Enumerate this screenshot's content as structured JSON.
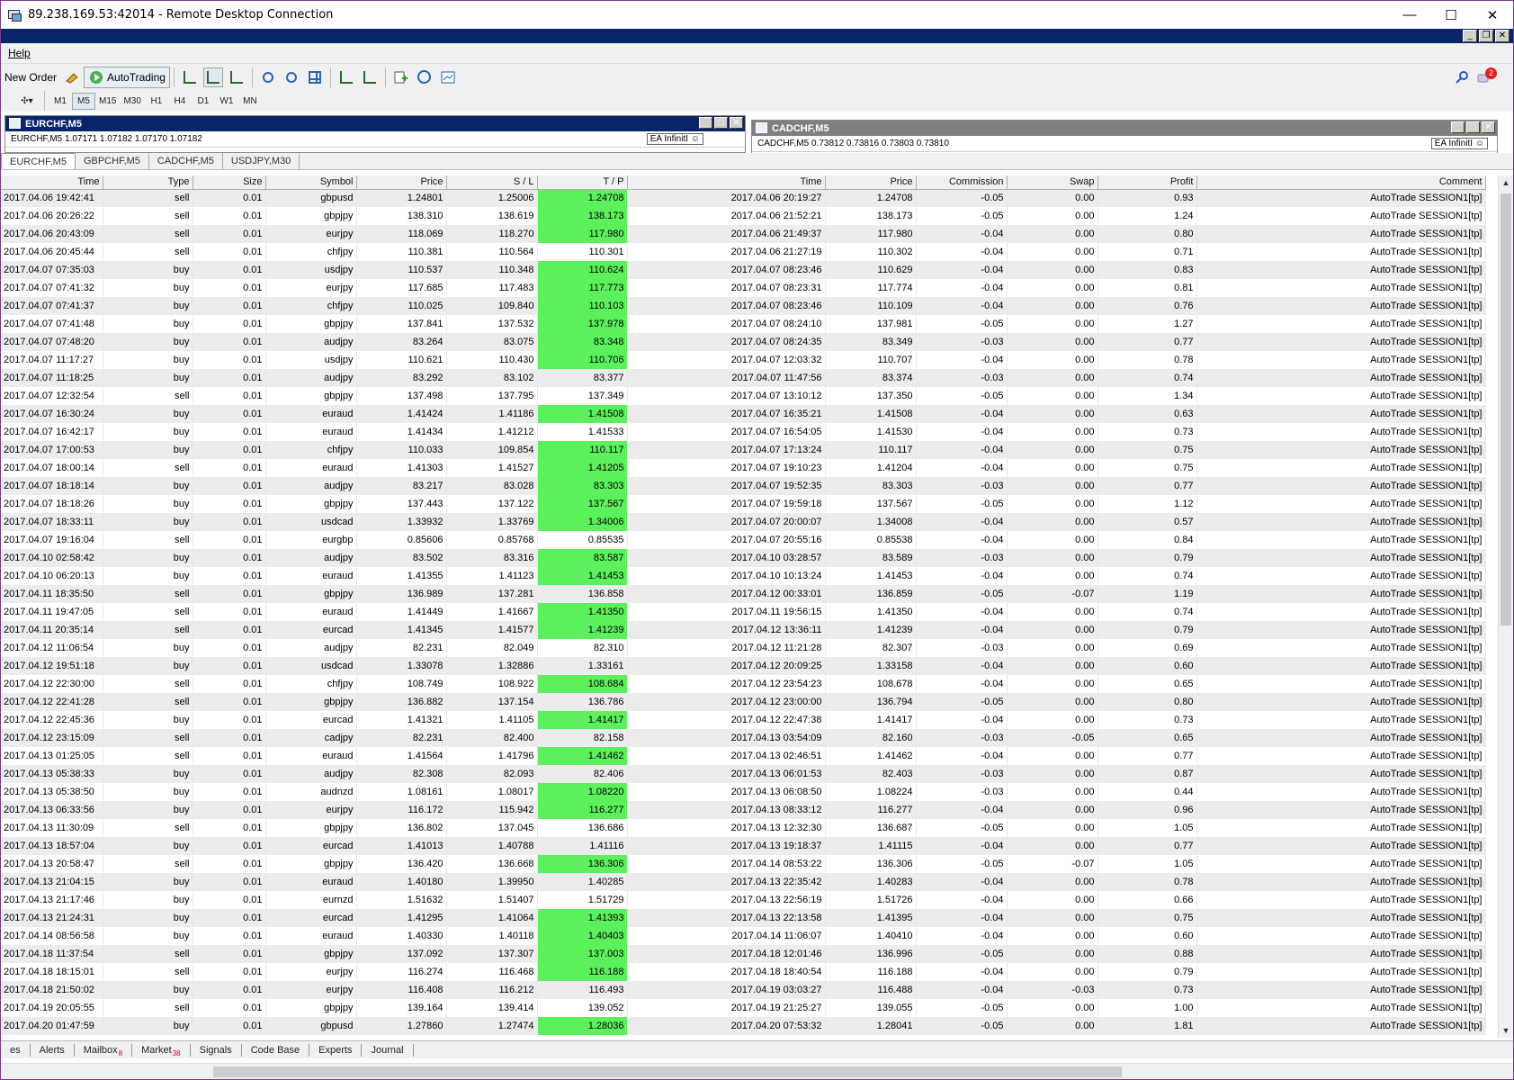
{
  "window": {
    "title": "89.238.169.53:42014 - Remote Desktop Connection",
    "minimize": "—",
    "maximize": "☐",
    "close": "✕"
  },
  "menu": {
    "help": "Help"
  },
  "toolbar": {
    "new_order": "New Order",
    "autotrading": "AutoTrading"
  },
  "timeframes": [
    "M1",
    "M5",
    "M15",
    "M30",
    "H1",
    "H4",
    "D1",
    "W1",
    "MN"
  ],
  "active_timeframe": "M5",
  "charts": {
    "left": {
      "title": "EURCHF,M5",
      "info": "EURCHF,M5  1.07171 1.07182 1.07170 1.07182",
      "ea": "EA InfinitI ☺"
    },
    "right": {
      "title": "CADCHF,M5",
      "info": "CADCHF,M5  0.73812 0.73816 0.73803 0.73810",
      "ea": "EA InfinitI ☺"
    }
  },
  "chart_tabs": [
    "EURCHF,M5",
    "GBPCHF,M5",
    "CADCHF,M5",
    "USDJPY,M30"
  ],
  "table": {
    "headers": [
      "Time",
      "Type",
      "Size",
      "Symbol",
      "Price",
      "S / L",
      "T / P",
      "Time",
      "Price",
      "Commission",
      "Swap",
      "Profit",
      "Comment"
    ],
    "rows": [
      [
        "2017.04.06 19:42:41",
        "sell",
        "0.01",
        "gbpusd",
        "1.24801",
        "1.25006",
        "1.24708",
        "2017.04.06 20:19:27",
        "1.24708",
        "-0.05",
        "0.00",
        "0.93",
        "AutoTrade SESSION1[tp]",
        1
      ],
      [
        "2017.04.06 20:26:22",
        "sell",
        "0.01",
        "gbpjpy",
        "138.310",
        "138.619",
        "138.173",
        "2017.04.06 21:52:21",
        "138.173",
        "-0.05",
        "0.00",
        "1.24",
        "AutoTrade SESSION1[tp]",
        1
      ],
      [
        "2017.04.06 20:43:09",
        "sell",
        "0.01",
        "eurjpy",
        "118.069",
        "118.270",
        "117.980",
        "2017.04.06 21:49:37",
        "117.980",
        "-0.04",
        "0.00",
        "0.80",
        "AutoTrade SESSION1[tp]",
        1
      ],
      [
        "2017.04.06 20:45:44",
        "sell",
        "0.01",
        "chfjpy",
        "110.381",
        "110.564",
        "110.301",
        "2017.04.06 21:27:19",
        "110.302",
        "-0.04",
        "0.00",
        "0.71",
        "AutoTrade SESSION1[tp]",
        0
      ],
      [
        "2017.04.07 07:35:03",
        "buy",
        "0.01",
        "usdjpy",
        "110.537",
        "110.348",
        "110.624",
        "2017.04.07 08:23:46",
        "110.629",
        "-0.04",
        "0.00",
        "0.83",
        "AutoTrade SESSION1[tp]",
        1
      ],
      [
        "2017.04.07 07:41:32",
        "buy",
        "0.01",
        "eurjpy",
        "117.685",
        "117.483",
        "117.773",
        "2017.04.07 08:23:31",
        "117.774",
        "-0.04",
        "0.00",
        "0.81",
        "AutoTrade SESSION1[tp]",
        1
      ],
      [
        "2017.04.07 07:41:37",
        "buy",
        "0.01",
        "chfjpy",
        "110.025",
        "109.840",
        "110.103",
        "2017.04.07 08:23:46",
        "110.109",
        "-0.04",
        "0.00",
        "0.76",
        "AutoTrade SESSION1[tp]",
        1
      ],
      [
        "2017.04.07 07:41:48",
        "buy",
        "0.01",
        "gbpjpy",
        "137.841",
        "137.532",
        "137.978",
        "2017.04.07 08:24:10",
        "137.981",
        "-0.05",
        "0.00",
        "1.27",
        "AutoTrade SESSION1[tp]",
        1
      ],
      [
        "2017.04.07 07:48:20",
        "buy",
        "0.01",
        "audjpy",
        "83.264",
        "83.075",
        "83.348",
        "2017.04.07 08:24:35",
        "83.349",
        "-0.03",
        "0.00",
        "0.77",
        "AutoTrade SESSION1[tp]",
        1
      ],
      [
        "2017.04.07 11:17:27",
        "buy",
        "0.01",
        "usdjpy",
        "110.621",
        "110.430",
        "110.706",
        "2017.04.07 12:03:32",
        "110.707",
        "-0.04",
        "0.00",
        "0.78",
        "AutoTrade SESSION1[tp]",
        1
      ],
      [
        "2017.04.07 11:18:25",
        "buy",
        "0.01",
        "audjpy",
        "83.292",
        "83.102",
        "83.377",
        "2017.04.07 11:47:56",
        "83.374",
        "-0.03",
        "0.00",
        "0.74",
        "AutoTrade SESSION1[tp]",
        0
      ],
      [
        "2017.04.07 12:32:54",
        "sell",
        "0.01",
        "gbpjpy",
        "137.498",
        "137.795",
        "137.349",
        "2017.04.07 13:10:12",
        "137.350",
        "-0.05",
        "0.00",
        "1.34",
        "AutoTrade SESSION1[tp]",
        0
      ],
      [
        "2017.04.07 16:30:24",
        "buy",
        "0.01",
        "euraud",
        "1.41424",
        "1.41186",
        "1.41508",
        "2017.04.07 16:35:21",
        "1.41508",
        "-0.04",
        "0.00",
        "0.63",
        "AutoTrade SESSION1[tp]",
        1
      ],
      [
        "2017.04.07 16:42:17",
        "buy",
        "0.01",
        "euraud",
        "1.41434",
        "1.41212",
        "1.41533",
        "2017.04.07 16:54:05",
        "1.41530",
        "-0.04",
        "0.00",
        "0.73",
        "AutoTrade SESSION1[tp]",
        0
      ],
      [
        "2017.04.07 17:00:53",
        "buy",
        "0.01",
        "chfjpy",
        "110.033",
        "109.854",
        "110.117",
        "2017.04.07 17:13:24",
        "110.117",
        "-0.04",
        "0.00",
        "0.75",
        "AutoTrade SESSION1[tp]",
        1
      ],
      [
        "2017.04.07 18:00:14",
        "sell",
        "0.01",
        "euraud",
        "1.41303",
        "1.41527",
        "1.41205",
        "2017.04.07 19:10:23",
        "1.41204",
        "-0.04",
        "0.00",
        "0.75",
        "AutoTrade SESSION1[tp]",
        1
      ],
      [
        "2017.04.07 18:18:14",
        "buy",
        "0.01",
        "audjpy",
        "83.217",
        "83.028",
        "83.303",
        "2017.04.07 19:52:35",
        "83.303",
        "-0.03",
        "0.00",
        "0.77",
        "AutoTrade SESSION1[tp]",
        1
      ],
      [
        "2017.04.07 18:18:26",
        "buy",
        "0.01",
        "gbpjpy",
        "137.443",
        "137.122",
        "137.567",
        "2017.04.07 19:59:18",
        "137.567",
        "-0.05",
        "0.00",
        "1.12",
        "AutoTrade SESSION1[tp]",
        1
      ],
      [
        "2017.04.07 18:33:11",
        "buy",
        "0.01",
        "usdcad",
        "1.33932",
        "1.33769",
        "1.34006",
        "2017.04.07 20:00:07",
        "1.34008",
        "-0.04",
        "0.00",
        "0.57",
        "AutoTrade SESSION1[tp]",
        1
      ],
      [
        "2017.04.07 19:16:04",
        "sell",
        "0.01",
        "eurgbp",
        "0.85606",
        "0.85768",
        "0.85535",
        "2017.04.07 20:55:16",
        "0.85538",
        "-0.04",
        "0.00",
        "0.84",
        "AutoTrade SESSION1[tp]",
        0
      ],
      [
        "2017.04.10 02:58:42",
        "buy",
        "0.01",
        "audjpy",
        "83.502",
        "83.316",
        "83.587",
        "2017.04.10 03:28:57",
        "83.589",
        "-0.03",
        "0.00",
        "0.79",
        "AutoTrade SESSION1[tp]",
        1
      ],
      [
        "2017.04.10 06:20:13",
        "buy",
        "0.01",
        "euraud",
        "1.41355",
        "1.41123",
        "1.41453",
        "2017.04.10 10:13:24",
        "1.41453",
        "-0.04",
        "0.00",
        "0.74",
        "AutoTrade SESSION1[tp]",
        1
      ],
      [
        "2017.04.11 18:35:50",
        "sell",
        "0.01",
        "gbpjpy",
        "136.989",
        "137.281",
        "136.858",
        "2017.04.12 00:33:01",
        "136.859",
        "-0.05",
        "-0.07",
        "1.19",
        "AutoTrade SESSION1[tp]",
        0
      ],
      [
        "2017.04.11 19:47:05",
        "sell",
        "0.01",
        "euraud",
        "1.41449",
        "1.41667",
        "1.41350",
        "2017.04.11 19:56:15",
        "1.41350",
        "-0.04",
        "0.00",
        "0.74",
        "AutoTrade SESSION1[tp]",
        1
      ],
      [
        "2017.04.11 20:35:14",
        "sell",
        "0.01",
        "eurcad",
        "1.41345",
        "1.41577",
        "1.41239",
        "2017.04.12 13:36:11",
        "1.41239",
        "-0.04",
        "0.00",
        "0.79",
        "AutoTrade SESSION1[tp]",
        1
      ],
      [
        "2017.04.12 11:06:54",
        "buy",
        "0.01",
        "audjpy",
        "82.231",
        "82.049",
        "82.310",
        "2017.04.12 11:21:28",
        "82.307",
        "-0.03",
        "0.00",
        "0.69",
        "AutoTrade SESSION1[tp]",
        0
      ],
      [
        "2017.04.12 19:51:18",
        "buy",
        "0.01",
        "usdcad",
        "1.33078",
        "1.32886",
        "1.33161",
        "2017.04.12 20:09:25",
        "1.33158",
        "-0.04",
        "0.00",
        "0.60",
        "AutoTrade SESSION1[tp]",
        0
      ],
      [
        "2017.04.12 22:30:00",
        "sell",
        "0.01",
        "chfjpy",
        "108.749",
        "108.922",
        "108.684",
        "2017.04.12 23:54:23",
        "108.678",
        "-0.04",
        "0.00",
        "0.65",
        "AutoTrade SESSION1[tp]",
        1
      ],
      [
        "2017.04.12 22:41:28",
        "sell",
        "0.01",
        "gbpjpy",
        "136.882",
        "137.154",
        "136.786",
        "2017.04.12 23:00:00",
        "136.794",
        "-0.05",
        "0.00",
        "0.80",
        "AutoTrade SESSION1[tp]",
        0
      ],
      [
        "2017.04.12 22:45:36",
        "buy",
        "0.01",
        "eurcad",
        "1.41321",
        "1.41105",
        "1.41417",
        "2017.04.12 22:47:38",
        "1.41417",
        "-0.04",
        "0.00",
        "0.73",
        "AutoTrade SESSION1[tp]",
        1
      ],
      [
        "2017.04.12 23:15:09",
        "sell",
        "0.01",
        "cadjpy",
        "82.231",
        "82.400",
        "82.158",
        "2017.04.13 03:54:09",
        "82.160",
        "-0.03",
        "-0.05",
        "0.65",
        "AutoTrade SESSION1[tp]",
        0
      ],
      [
        "2017.04.13 01:25:05",
        "sell",
        "0.01",
        "euraud",
        "1.41564",
        "1.41796",
        "1.41462",
        "2017.04.13 02:46:51",
        "1.41462",
        "-0.04",
        "0.00",
        "0.77",
        "AutoTrade SESSION1[tp]",
        1
      ],
      [
        "2017.04.13 05:38:33",
        "buy",
        "0.01",
        "audjpy",
        "82.308",
        "82.093",
        "82.406",
        "2017.04.13 06:01:53",
        "82.403",
        "-0.03",
        "0.00",
        "0.87",
        "AutoTrade SESSION1[tp]",
        0
      ],
      [
        "2017.04.13 05:38:50",
        "buy",
        "0.01",
        "audnzd",
        "1.08161",
        "1.08017",
        "1.08220",
        "2017.04.13 06:08:50",
        "1.08224",
        "-0.03",
        "0.00",
        "0.44",
        "AutoTrade SESSION1[tp]",
        1
      ],
      [
        "2017.04.13 06:33:56",
        "buy",
        "0.01",
        "eurjpy",
        "116.172",
        "115.942",
        "116.277",
        "2017.04.13 08:33:12",
        "116.277",
        "-0.04",
        "0.00",
        "0.96",
        "AutoTrade SESSION1[tp]",
        1
      ],
      [
        "2017.04.13 11:30:09",
        "sell",
        "0.01",
        "gbpjpy",
        "136.802",
        "137.045",
        "136.686",
        "2017.04.13 12:32:30",
        "136.687",
        "-0.05",
        "0.00",
        "1.05",
        "AutoTrade SESSION1[tp]",
        0
      ],
      [
        "2017.04.13 18:57:04",
        "buy",
        "0.01",
        "eurcad",
        "1.41013",
        "1.40788",
        "1.41116",
        "2017.04.13 19:18:37",
        "1.41115",
        "-0.04",
        "0.00",
        "0.77",
        "AutoTrade SESSION1[tp]",
        0
      ],
      [
        "2017.04.13 20:58:47",
        "sell",
        "0.01",
        "gbpjpy",
        "136.420",
        "136.668",
        "136.306",
        "2017.04.14 08:53:22",
        "136.306",
        "-0.05",
        "-0.07",
        "1.05",
        "AutoTrade SESSION1[tp]",
        1
      ],
      [
        "2017.04.13 21:04:15",
        "buy",
        "0.01",
        "euraud",
        "1.40180",
        "1.39950",
        "1.40285",
        "2017.04.13 22:35:42",
        "1.40283",
        "-0.04",
        "0.00",
        "0.78",
        "AutoTrade SESSION1[tp]",
        0
      ],
      [
        "2017.04.13 21:17:46",
        "buy",
        "0.01",
        "eurnzd",
        "1.51632",
        "1.51407",
        "1.51729",
        "2017.04.13 22:56:19",
        "1.51726",
        "-0.04",
        "0.00",
        "0.66",
        "AutoTrade SESSION1[tp]",
        0
      ],
      [
        "2017.04.13 21:24:31",
        "buy",
        "0.01",
        "eurcad",
        "1.41295",
        "1.41064",
        "1.41393",
        "2017.04.13 22:13:58",
        "1.41395",
        "-0.04",
        "0.00",
        "0.75",
        "AutoTrade SESSION1[tp]",
        1
      ],
      [
        "2017.04.14 08:56:58",
        "buy",
        "0.01",
        "euraud",
        "1.40330",
        "1.40118",
        "1.40403",
        "2017.04.14 11:06:07",
        "1.40410",
        "-0.04",
        "0.00",
        "0.60",
        "AutoTrade SESSION1[tp]",
        1
      ],
      [
        "2017.04.18 11:37:54",
        "sell",
        "0.01",
        "gbpjpy",
        "137.092",
        "137.307",
        "137.003",
        "2017.04.18 12:01:46",
        "136.996",
        "-0.05",
        "0.00",
        "0.88",
        "AutoTrade SESSION1[tp]",
        1
      ],
      [
        "2017.04.18 18:15:01",
        "sell",
        "0.01",
        "eurjpy",
        "116.274",
        "116.468",
        "116.188",
        "2017.04.18 18:40:54",
        "116.188",
        "-0.04",
        "0.00",
        "0.79",
        "AutoTrade SESSION1[tp]",
        1
      ],
      [
        "2017.04.18 21:50:02",
        "buy",
        "0.01",
        "eurjpy",
        "116.408",
        "116.212",
        "116.493",
        "2017.04.19 03:03:27",
        "116.488",
        "-0.04",
        "-0.03",
        "0.73",
        "AutoTrade SESSION1[tp]",
        0
      ],
      [
        "2017.04.19 20:05:55",
        "sell",
        "0.01",
        "gbpjpy",
        "139.164",
        "139.414",
        "139.052",
        "2017.04.19 21:25:27",
        "139.055",
        "-0.05",
        "0.00",
        "1.00",
        "AutoTrade SESSION1[tp]",
        0
      ],
      [
        "2017.04.20 01:47:59",
        "buy",
        "0.01",
        "gbpusd",
        "1.27860",
        "1.27474",
        "1.28036",
        "2017.04.20 07:53:32",
        "1.28041",
        "-0.05",
        "0.00",
        "1.81",
        "AutoTrade SESSION1[tp]",
        1
      ]
    ]
  },
  "bottom_tabs": [
    {
      "label": "es",
      "badge": ""
    },
    {
      "label": "Alerts",
      "badge": ""
    },
    {
      "label": "Mailbox",
      "badge": "8"
    },
    {
      "label": "Market",
      "badge": "38"
    },
    {
      "label": "Signals",
      "badge": ""
    },
    {
      "label": "Code Base",
      "badge": ""
    },
    {
      "label": "Experts",
      "badge": ""
    },
    {
      "label": "Journal",
      "badge": ""
    }
  ],
  "notifications_count": "2",
  "colors": {
    "tp_hit": "#5cf05c",
    "title_active": "#0a246a",
    "title_inactive": "#808080"
  }
}
